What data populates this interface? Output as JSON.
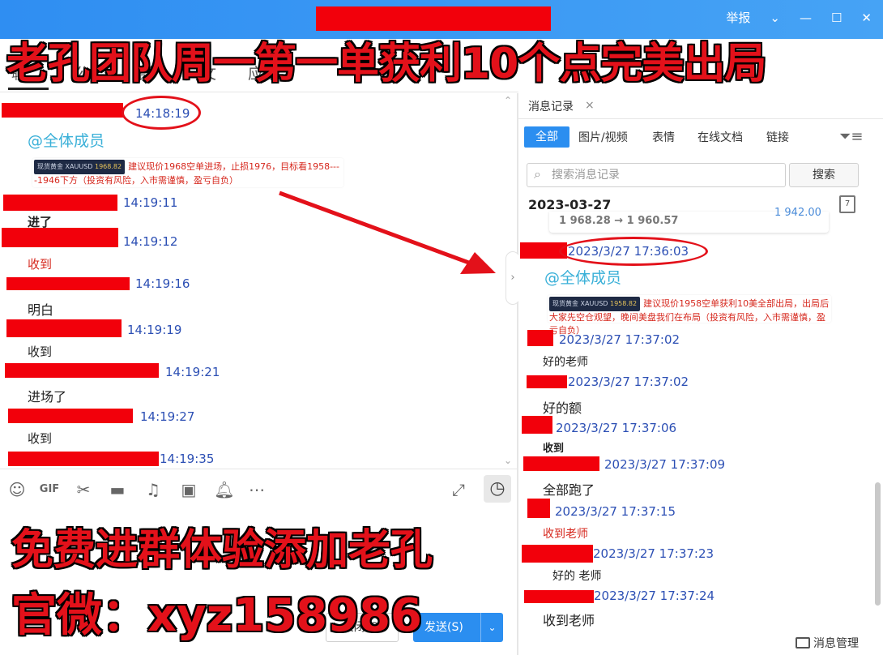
{
  "window": {
    "report_label": "举报",
    "min_icon": "minimize-icon",
    "max_icon": "maximize-icon",
    "close_icon": "close-icon"
  },
  "left_tabs": {
    "items": [
      "聊",
      "公",
      "群",
      "文",
      "应用"
    ],
    "active": 0
  },
  "chat": {
    "messages": [
      {
        "time": "14:18:19",
        "text": ""
      },
      {
        "mention": "@全体成员"
      },
      {
        "card": {
          "ticker": "现货黄金 XAUUSD",
          "price": "1968.82",
          "text": "建议现价1968空单进场，止损1976，目标看1958----1946下方（投资有风险，入市需谨慎，盈亏自负）"
        }
      },
      {
        "time": "14:19:11",
        "text": "进了"
      },
      {
        "time": "14:19:12",
        "text": "收到"
      },
      {
        "time": "14:19:16",
        "text": "明白"
      },
      {
        "time": "14:19:19",
        "text": "收到"
      },
      {
        "time": "14:19:21",
        "text": "进场了"
      },
      {
        "time": "14:19:27",
        "text": "收到"
      },
      {
        "time": "14:19:35",
        "text": ""
      }
    ]
  },
  "toolbar": {
    "icons": [
      "emoji-icon",
      "gif-icon",
      "scissors-icon",
      "folder-icon",
      "music-icon",
      "image-icon",
      "bell-icon",
      "more-icon",
      "expand-icon",
      "clock-icon"
    ]
  },
  "input": {
    "close_label": "关闭(C)",
    "send_label": "发送(S)"
  },
  "right_panel": {
    "tab_label": "消息记录",
    "filters": [
      "全部",
      "图片/视频",
      "表情",
      "在线文档",
      "链接"
    ],
    "search_placeholder": "搜索消息记录",
    "search_button": "搜索",
    "date": "2023-03-27",
    "calendar_day": "7",
    "price_line": "1 968.28 → 1 960.57",
    "price_right": "1 942.00",
    "messages": [
      {
        "time": "2023/3/27 17:36:03"
      },
      {
        "mention": "@全体成员"
      },
      {
        "card": {
          "ticker": "现货黄金 XAUUSD",
          "price": "1958.82",
          "text": "建议现价1958空单获利10美全部出局，出局后大家先空仓观望，晚间美盘我们在布局（投资有风险，入市需谨慎，盈亏自负）"
        }
      },
      {
        "time": "2023/3/27 17:37:02",
        "text": "好的老师"
      },
      {
        "time": "2023/3/27 17:37:02",
        "text": "好的额"
      },
      {
        "time": "2023/3/27 17:37:06",
        "text": "收到"
      },
      {
        "time": "2023/3/27 17:37:09",
        "text": "全部跑了"
      },
      {
        "time": "2023/3/27 17:37:15",
        "text": "收到老师"
      },
      {
        "time": "2023/3/27 17:37:23",
        "text": "好的 老师"
      },
      {
        "time": "2023/3/27 17:37:24",
        "text": "收到老师"
      }
    ],
    "manage_label": "消息管理"
  },
  "overlays": {
    "top": "老孔团队周一第一单获利10个点完美出局",
    "bottom1": "免费进群体验添加老孔",
    "bottom2": "官微：xyz158986"
  },
  "colors": {
    "accent": "#2b8ef0",
    "overlay_red": "#e3111a",
    "timestamp": "#2c4fb4",
    "mention": "#3ab0d8"
  }
}
